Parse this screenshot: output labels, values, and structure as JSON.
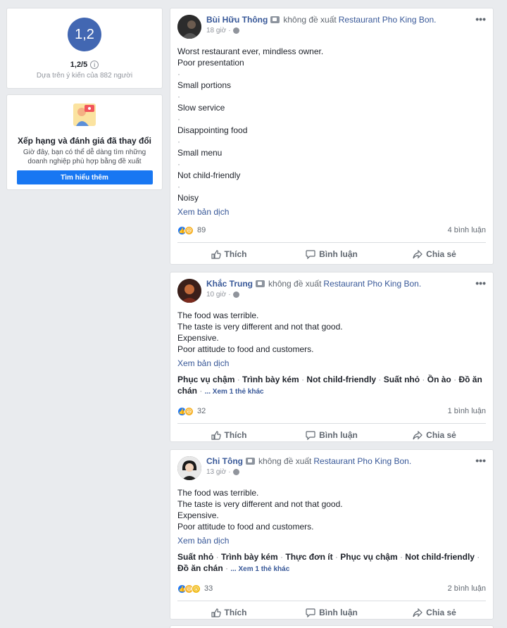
{
  "rating": {
    "score_circle": "1,2",
    "score_text": "1,2/5",
    "info_glyph": "i",
    "based_on": "Dựa trên ý kiến của 882 người"
  },
  "promo": {
    "title": "Xếp hạng và đánh giá đã thay đổi",
    "description": "Giờ đây, bạn có thể dễ dàng tìm những doanh nghiệp phù hợp bằng đề xuất",
    "button_label": "Tìm hiểu thêm"
  },
  "common": {
    "recommend_text": "không đề xuất",
    "page_name": "Restaurant Pho King Bon.",
    "see_translation": "Xem bản dịch",
    "like_label": "Thích",
    "comment_label": "Bình luận",
    "share_label": "Chia sẻ",
    "more_glyph": "•••"
  },
  "posts": [
    {
      "author": "Bùi Hữu Thông",
      "time": "18 giờ",
      "lines": [
        "Worst restaurant ever, mindless owner.",
        "Poor presentation",
        "·",
        "Small portions",
        "·",
        "Slow service",
        "·",
        "Disappointing food",
        "·",
        "Small menu",
        "·",
        "Not child-friendly",
        "·",
        "Noisy"
      ],
      "reaction_count": "89",
      "comments": "4 bình luận"
    },
    {
      "author": "Khắc Trung",
      "time": "10 giờ",
      "lines": [
        "The food was terrible.",
        "The taste is very different and not that good.",
        "Expensive.",
        "Poor attitude to food and customers."
      ],
      "tags": [
        "Phục vụ chậm",
        "Trình bày kém",
        "Not child-friendly",
        "Suất nhỏ",
        "Ồn ào",
        "Đồ ăn chán"
      ],
      "more_tags": "... Xem 1 thẻ khác",
      "reaction_count": "32",
      "comments": "1 bình luận"
    },
    {
      "author": "Chi Tông",
      "time": "13 giờ",
      "lines": [
        "The food was terrible.",
        "The taste is very different and not that good.",
        "Expensive.",
        "Poor attitude to food and customers."
      ],
      "tags": [
        "Suất nhỏ",
        "Trình bày kém",
        "Thực đơn ít",
        "Phục vụ chậm",
        "Not child-friendly",
        "Đồ ăn chán"
      ],
      "more_tags": "... Xem 1 thẻ khác",
      "reaction_count": "33",
      "comments": "2 bình luận"
    }
  ],
  "colors": {
    "background": "#e9ebee",
    "accent": "#4267b2",
    "link": "#385898",
    "button": "#1877f2"
  }
}
